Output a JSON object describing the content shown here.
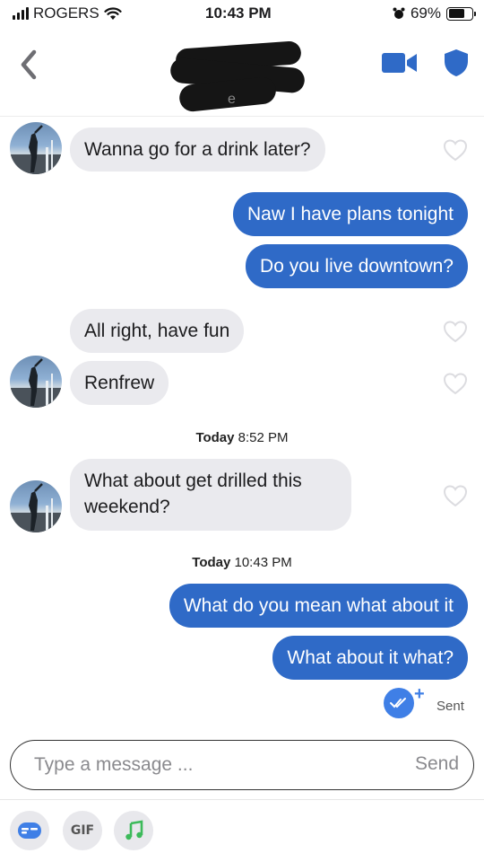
{
  "status_bar": {
    "carrier": "ROGERS",
    "time": "10:43 PM",
    "battery": "69%",
    "battery_level": 0.69
  },
  "header": {
    "name_visible_fragment": "e",
    "accent_color": "#2f6ac7"
  },
  "messages": [
    {
      "direction": "in",
      "text": "Wanna go for a drink later?"
    },
    {
      "direction": "out",
      "text": "Naw I have plans tonight"
    },
    {
      "direction": "out",
      "text": "Do you live downtown?"
    },
    {
      "direction": "in",
      "text": "All right, have fun"
    },
    {
      "direction": "in",
      "text": "Renfrew"
    },
    {
      "direction": "in",
      "text": "What about get drilled this\nweekend?"
    },
    {
      "direction": "out",
      "text": "What do you mean what about it"
    },
    {
      "direction": "out",
      "text": "What about it what?"
    }
  ],
  "timestamps": [
    {
      "day": "Today",
      "time": "8:52 PM"
    },
    {
      "day": "Today",
      "time": "10:43 PM"
    }
  ],
  "receipt": {
    "status": "Sent",
    "plus": "+"
  },
  "composer": {
    "placeholder": "Type a message ...",
    "send_label": "Send"
  },
  "tools": {
    "gif_label": "GIF",
    "icons": [
      "sticker-icon",
      "gif-button",
      "music-note-icon"
    ]
  }
}
